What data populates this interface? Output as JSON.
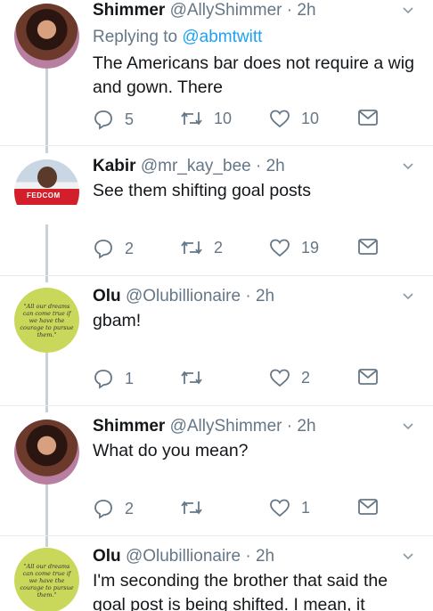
{
  "tweets": [
    {
      "name": "Shimmer",
      "handle": "@AllyShimmer",
      "time": "· 2h",
      "reply_prefix": "Replying to",
      "reply_handle": "@abmtwitt",
      "text": "The Americans bar does not require a wig and gown. There",
      "replies": "5",
      "retweets": "10",
      "likes": "10",
      "avatar": "shimmer-avatar"
    },
    {
      "name": "Kabir",
      "handle": "@mr_kay_bee",
      "time": "· 2h",
      "text": "See them shifting goal posts",
      "replies": "2",
      "retweets": "2",
      "likes": "19",
      "avatar": "kabir-avatar",
      "avatar_jersey_text": "FEDCOM"
    },
    {
      "name": "Olu",
      "handle": "@Olubillionaire",
      "time": "· 2h",
      "text": "gbam!",
      "replies": "1",
      "retweets": "",
      "likes": "2",
      "avatar": "olu-avatar",
      "avatar_quote": "\"All our dreams can come true if we have the courage to pursue them.\""
    },
    {
      "name": "Shimmer",
      "handle": "@AllyShimmer",
      "time": "· 2h",
      "text": "What do you mean?",
      "replies": "2",
      "retweets": "",
      "likes": "1",
      "avatar": "shimmer-avatar"
    },
    {
      "name": "Olu",
      "handle": "@Olubillionaire",
      "time": "· 2h",
      "text": "I'm seconding the brother that said the goal post is being shifted. I mean, it",
      "avatar": "olu-avatar",
      "avatar_quote": "\"All our dreams can come true if we have the courage to pursue them.\""
    }
  ],
  "colors": {
    "link": "#1da1f2",
    "muted": "#657786",
    "thread_line": "#c8d1d8",
    "olu_avatar_bg": "#c9d85a"
  },
  "icons": [
    "reply-icon",
    "retweet-icon",
    "like-icon",
    "message-icon",
    "chevron-down-icon"
  ]
}
